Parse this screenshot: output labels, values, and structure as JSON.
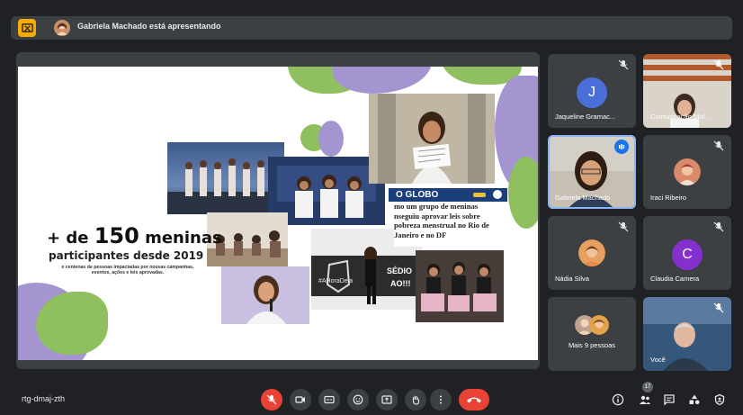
{
  "topbar": {
    "presenter_text": "Gabriela Machado está apresentando",
    "present_icon": "present-to-all-icon"
  },
  "slide": {
    "headline_prefix": "+ de ",
    "headline_number": "150",
    "headline_suffix": " meninas",
    "subheadline": "participantes desde 2019",
    "small_text": "e centenas de pessoas impactadas por nossas campanhas, eventos, ações e leis aprovadas.",
    "news_brand": "O GLOBO",
    "news_lines": [
      "mo um grupo de meninas",
      "nseguiu aprovar leis sobre",
      "pobreza menstrual no Rio de",
      "Janeiro e no DF"
    ],
    "banner_text_1": "#AHoraDela",
    "banner_text_2": "SÉDIO",
    "banner_text_3": "AO!!!"
  },
  "participants": [
    {
      "name": "Jaqueline Gramac...",
      "initial": "J",
      "color": "#4a6fd8",
      "muted": true,
      "type": "avatar"
    },
    {
      "name": "Comunicação Mul...",
      "muted": true,
      "type": "video"
    },
    {
      "name": "Gabriela Machado",
      "muted": false,
      "speaking": true,
      "type": "video"
    },
    {
      "name": "Iraci Ribeiro",
      "muted": true,
      "type": "photo"
    },
    {
      "name": "Nádia Silva",
      "muted": true,
      "type": "photo"
    },
    {
      "name": "Claudia Camera",
      "initial": "C",
      "color": "#8430ce",
      "muted": true,
      "type": "avatar"
    },
    {
      "name": "Mais 9 pessoas",
      "type": "more"
    },
    {
      "name": "Você",
      "muted": true,
      "type": "video"
    }
  ],
  "bottombar": {
    "meeting_code": "rtg-dmaj-zth",
    "people_count": "17",
    "controls": [
      "mic-off-icon",
      "camera-icon",
      "captions-icon",
      "emoji-icon",
      "present-icon",
      "raise-hand-icon",
      "more-options-icon",
      "end-call-icon"
    ],
    "right_icons": [
      "info-icon",
      "people-icon",
      "chat-icon",
      "activities-icon",
      "host-controls-icon"
    ]
  },
  "colors": {
    "background": "#202124",
    "tile": "#3c4043",
    "accent_blue": "#8ab4f8",
    "red": "#ea4335",
    "present_yellow": "#f9ab00",
    "blob_green": "#8fbf5f",
    "blob_purple": "#9b8cc4"
  }
}
